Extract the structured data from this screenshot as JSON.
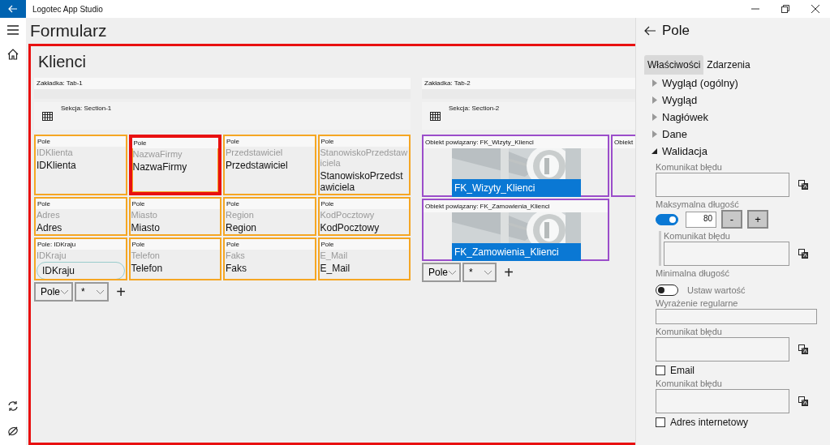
{
  "window": {
    "title": "Logotec App Studio"
  },
  "page": {
    "title": "Formularz"
  },
  "form": {
    "title": "Klienci",
    "tab_1": {
      "header": "Zakładka: Tab-1",
      "section": "Sekcja: Section-1",
      "fields": [
        {
          "kind": "text",
          "header": "Pole",
          "caption": "IDKlienta",
          "value": "IDKlienta",
          "selected": false
        },
        {
          "kind": "text",
          "header": "Pole",
          "caption": "NazwaFirmy",
          "value": "NazwaFirmy",
          "selected": true
        },
        {
          "kind": "text",
          "header": "Pole",
          "caption": "Przedstawiciel",
          "value": "Przedstawiciel",
          "selected": false
        },
        {
          "kind": "text",
          "header": "Pole",
          "caption": "StanowiskoPrzedstawiciela",
          "value": "StanowiskoPrzedstawiciela",
          "selected": false
        },
        {
          "kind": "text",
          "header": "Pole",
          "caption": "Adres",
          "value": "Adres",
          "selected": false
        },
        {
          "kind": "text",
          "header": "Pole",
          "caption": "Miasto",
          "value": "Miasto",
          "selected": false
        },
        {
          "kind": "text",
          "header": "Pole",
          "caption": "Region",
          "value": "Region",
          "selected": false
        },
        {
          "kind": "text",
          "header": "Pole",
          "caption": "KodPocztowy",
          "value": "KodPocztowy",
          "selected": false
        },
        {
          "kind": "lookup",
          "header": "Pole: IDKraju",
          "caption": "IDKraju",
          "value": "IDKraju",
          "selected": false
        },
        {
          "kind": "text",
          "header": "Pole",
          "caption": "Telefon",
          "value": "Telefon",
          "selected": false
        },
        {
          "kind": "text",
          "header": "Pole",
          "caption": "Faks",
          "value": "Faks",
          "selected": false
        },
        {
          "kind": "text",
          "header": "Pole",
          "caption": "E_Mail",
          "value": "E_Mail",
          "selected": false
        }
      ],
      "add_row": {
        "type": "Pole",
        "filter": "*",
        "add": "+"
      }
    },
    "tab_2": {
      "header": "Zakładka: Tab-2",
      "section": "Sekcja: Section-2",
      "object_rows": [
        [
          {
            "header": "Obiekt powiązany: FK_Wizyty_Klienci",
            "name": "FK_Wizyty_Klienci"
          },
          {
            "header": "Obiekt"
          }
        ],
        [
          {
            "header": "Obiekt powiązany: FK_Zamowienia_Klienci",
            "name": "FK_Zamowienia_Klienci"
          }
        ]
      ],
      "add_row": {
        "type": "Pole",
        "filter": "*",
        "add": "+"
      }
    }
  },
  "panel": {
    "title": "Pole",
    "tabs": [
      {
        "label": "Właściwości",
        "selected": true
      },
      {
        "label": "Zdarzenia",
        "selected": false
      }
    ],
    "groups": [
      {
        "label": "Wygląd (ogólny)",
        "expanded": false
      },
      {
        "label": "Wygląd",
        "expanded": false
      },
      {
        "label": "Nagłówek",
        "expanded": false
      },
      {
        "label": "Dane",
        "expanded": false
      },
      {
        "label": "Walidacja",
        "expanded": true,
        "children": [
          {
            "kind": "textarea",
            "label": "Komunikat błędu"
          },
          {
            "kind": "length",
            "label": "Maksymalna długość",
            "on": true,
            "value": "80",
            "minus": "-",
            "plus": "+",
            "children": [
              {
                "kind": "textarea",
                "label": "Komunikat błędu"
              }
            ]
          },
          {
            "kind": "toggle",
            "label": "Minimalna długość",
            "on": false,
            "text": "Ustaw wartość"
          },
          {
            "kind": "input",
            "label": "Wyrażenie regularne"
          },
          {
            "kind": "textarea",
            "label": "Komunikat błędu"
          },
          {
            "kind": "checkbox",
            "label": "Email",
            "checked": false
          },
          {
            "kind": "textarea",
            "label": "Komunikat błędu"
          },
          {
            "kind": "checkbox",
            "label": "Adres internetowy",
            "checked": false
          }
        ]
      }
    ]
  }
}
